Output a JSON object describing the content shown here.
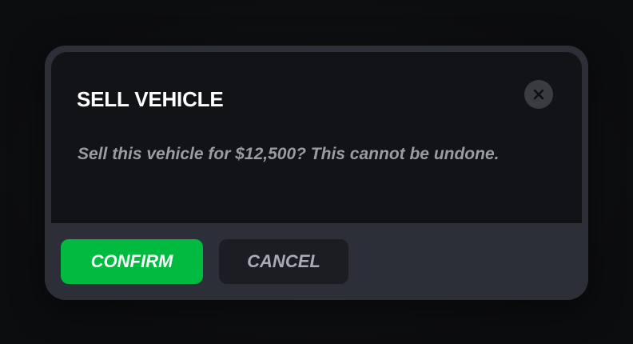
{
  "dialog": {
    "title": "SELL VEHICLE",
    "message": "Sell this vehicle for $12,500? This cannot be undone.",
    "close_icon": "close-icon"
  },
  "actions": {
    "confirm_label": "CONFIRM",
    "cancel_label": "CANCEL"
  },
  "colors": {
    "confirm": "#00bb3f",
    "cancel": "#1c1d22",
    "frame": "#2c2f38",
    "body": "#121316"
  }
}
